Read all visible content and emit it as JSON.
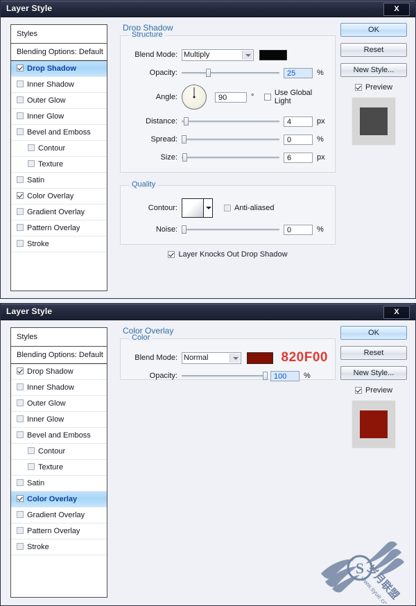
{
  "dialog1": {
    "title": "Layer Style",
    "close_label": "X",
    "styles_panel": {
      "header": "Styles",
      "blending_options": "Blending Options: Default",
      "items": [
        {
          "label": "Drop Shadow",
          "checked": true,
          "selected": true,
          "sub": false
        },
        {
          "label": "Inner Shadow",
          "checked": false,
          "selected": false,
          "sub": false
        },
        {
          "label": "Outer Glow",
          "checked": false,
          "selected": false,
          "sub": false
        },
        {
          "label": "Inner Glow",
          "checked": false,
          "selected": false,
          "sub": false
        },
        {
          "label": "Bevel and Emboss",
          "checked": false,
          "selected": false,
          "sub": false
        },
        {
          "label": "Contour",
          "checked": false,
          "selected": false,
          "sub": true
        },
        {
          "label": "Texture",
          "checked": false,
          "selected": false,
          "sub": true
        },
        {
          "label": "Satin",
          "checked": false,
          "selected": false,
          "sub": false
        },
        {
          "label": "Color Overlay",
          "checked": true,
          "selected": false,
          "sub": false
        },
        {
          "label": "Gradient Overlay",
          "checked": false,
          "selected": false,
          "sub": false
        },
        {
          "label": "Pattern Overlay",
          "checked": false,
          "selected": false,
          "sub": false
        },
        {
          "label": "Stroke",
          "checked": false,
          "selected": false,
          "sub": false
        }
      ]
    },
    "pane_title": "Drop Shadow",
    "structure": {
      "group_label": "Structure",
      "blend_mode_label": "Blend Mode:",
      "blend_mode_value": "Multiply",
      "shadow_color": "#060607",
      "opacity_label": "Opacity:",
      "opacity_value": "25",
      "opacity_unit": "%",
      "angle_label": "Angle:",
      "angle_value": "90",
      "angle_unit": "°",
      "use_global_light": "Use Global Light",
      "use_global_light_checked": false,
      "distance_label": "Distance:",
      "distance_value": "4",
      "distance_unit": "px",
      "spread_label": "Spread:",
      "spread_value": "0",
      "spread_unit": "%",
      "size_label": "Size:",
      "size_value": "6",
      "size_unit": "px"
    },
    "quality": {
      "group_label": "Quality",
      "contour_label": "Contour:",
      "anti_aliased": "Anti-aliased",
      "anti_aliased_checked": false,
      "noise_label": "Noise:",
      "noise_value": "0",
      "noise_unit": "%"
    },
    "knockout": {
      "label": "Layer Knocks Out Drop Shadow",
      "checked": true
    },
    "buttons": {
      "ok": "OK",
      "reset": "Reset",
      "new_style": "New Style...",
      "preview": "Preview",
      "preview_checked": true
    },
    "preview_color": "#4a4a4a"
  },
  "dialog2": {
    "title": "Layer Style",
    "close_label": "X",
    "styles_panel": {
      "header": "Styles",
      "blending_options": "Blending Options: Default",
      "items": [
        {
          "label": "Drop Shadow",
          "checked": true,
          "selected": false,
          "sub": false
        },
        {
          "label": "Inner Shadow",
          "checked": false,
          "selected": false,
          "sub": false
        },
        {
          "label": "Outer Glow",
          "checked": false,
          "selected": false,
          "sub": false
        },
        {
          "label": "Inner Glow",
          "checked": false,
          "selected": false,
          "sub": false
        },
        {
          "label": "Bevel and Emboss",
          "checked": false,
          "selected": false,
          "sub": false
        },
        {
          "label": "Contour",
          "checked": false,
          "selected": false,
          "sub": true
        },
        {
          "label": "Texture",
          "checked": false,
          "selected": false,
          "sub": true
        },
        {
          "label": "Satin",
          "checked": false,
          "selected": false,
          "sub": false
        },
        {
          "label": "Color Overlay",
          "checked": true,
          "selected": true,
          "sub": false
        },
        {
          "label": "Gradient Overlay",
          "checked": false,
          "selected": false,
          "sub": false
        },
        {
          "label": "Pattern Overlay",
          "checked": false,
          "selected": false,
          "sub": false
        },
        {
          "label": "Stroke",
          "checked": false,
          "selected": false,
          "sub": false
        }
      ]
    },
    "pane_title": "Color Overlay",
    "color_group": {
      "group_label": "Color",
      "blend_mode_label": "Blend Mode:",
      "blend_mode_value": "Normal",
      "overlay_color": "#820F00",
      "hex_annotation": "820F00",
      "hex_annotation_color": "#e03a32",
      "opacity_label": "Opacity:",
      "opacity_value": "100",
      "opacity_unit": "%"
    },
    "buttons": {
      "ok": "OK",
      "reset": "Reset",
      "new_style": "New Style...",
      "preview": "Preview",
      "preview_checked": true
    },
    "preview_color": "#8c1508"
  },
  "watermark": {
    "brand": "岁月联盟",
    "url": "www.syue.com",
    "mark": "S"
  }
}
